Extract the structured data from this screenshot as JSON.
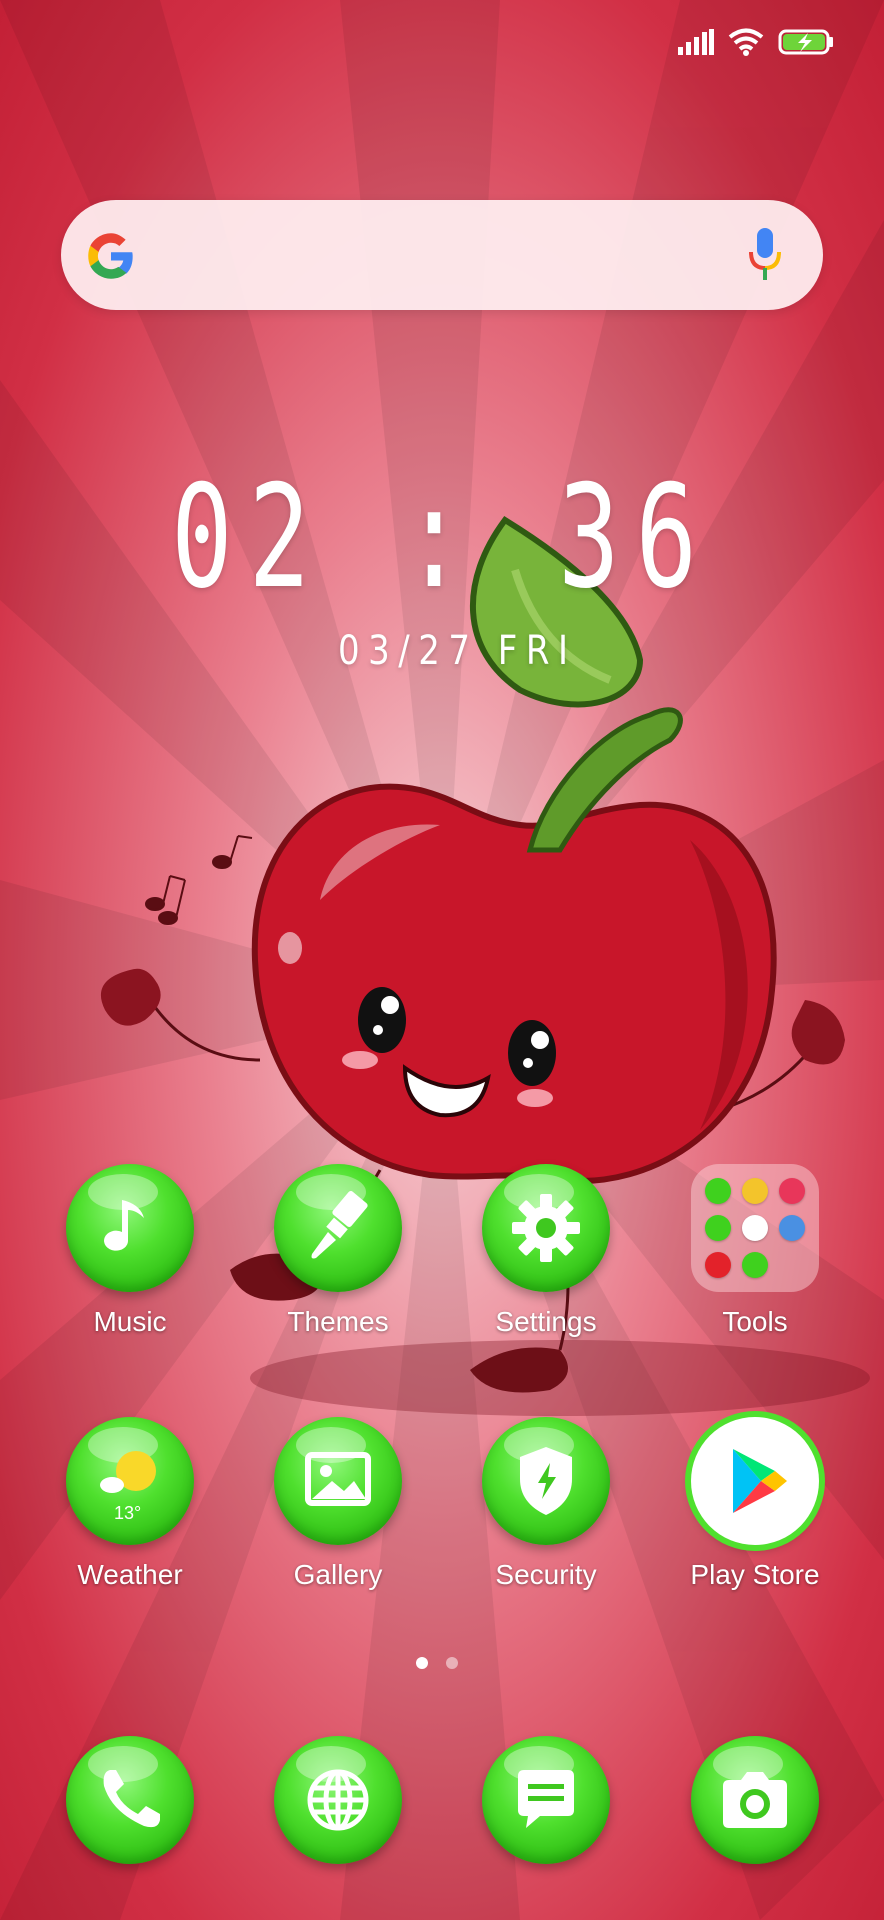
{
  "clock": {
    "time": "02 : 36",
    "date": "03/27  FRI"
  },
  "search": {
    "google_icon": "google-g-icon",
    "mic_icon": "mic-icon"
  },
  "status": {
    "icons": [
      "signal-icon",
      "wifi-icon",
      "battery-charging-icon"
    ]
  },
  "home_apps": [
    {
      "label": "Music",
      "icon": "music-note-icon"
    },
    {
      "label": "Themes",
      "icon": "paintbrush-icon"
    },
    {
      "label": "Settings",
      "icon": "gear-icon"
    },
    {
      "label": "Tools",
      "icon": "folder-icon"
    },
    {
      "label": "Weather",
      "icon": "weather-icon",
      "temp": "13°"
    },
    {
      "label": "Gallery",
      "icon": "image-icon"
    },
    {
      "label": "Security",
      "icon": "shield-icon"
    },
    {
      "label": "Play Store",
      "icon": "play-store-icon"
    }
  ],
  "dock": [
    {
      "name": "phone",
      "icon": "phone-icon"
    },
    {
      "name": "browser",
      "icon": "globe-icon"
    },
    {
      "name": "messaging",
      "icon": "message-icon"
    },
    {
      "name": "camera",
      "icon": "camera-icon"
    }
  ],
  "page_indicator": {
    "pages": 2,
    "current": 1
  },
  "colors": {
    "background": "#c81e35",
    "accent_green": "#3fd11e",
    "text": "#ffffff"
  }
}
